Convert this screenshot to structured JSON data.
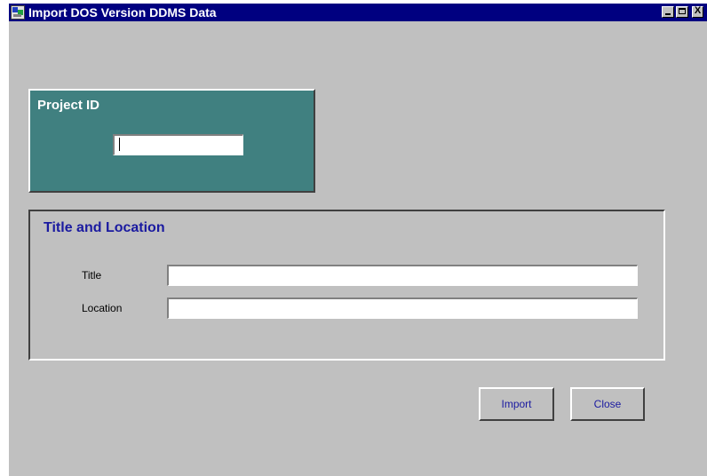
{
  "window": {
    "title": "Import DOS Version DDMS Data",
    "icons": [
      "app-icon",
      "minimize-icon",
      "maximize-icon",
      "close-icon"
    ],
    "close_glyph": "X"
  },
  "project": {
    "label": "Project ID",
    "value": ""
  },
  "title_location": {
    "heading": "Title and Location",
    "title_label": "Title",
    "title_value": "",
    "location_label": "Location",
    "location_value": ""
  },
  "actions": {
    "import_label": "Import",
    "close_label": "Close"
  },
  "colors": {
    "titlebar": "#000080",
    "window_bg": "#c0c0c0",
    "project_panel": "#408080",
    "accent_text": "#1a1aa0"
  }
}
